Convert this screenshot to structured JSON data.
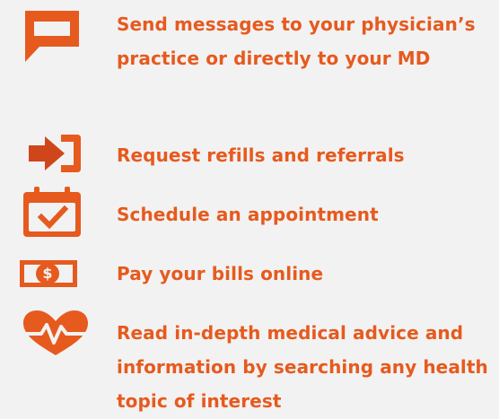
{
  "features": {
    "messages": {
      "icon": "chat-bubble-icon",
      "label": "Send messages to your physician’s practice or directly to your MD"
    },
    "refills": {
      "icon": "arrow-into-door-icon",
      "label": "Request refills and referrals"
    },
    "appointment": {
      "icon": "calendar-check-icon",
      "label": "Schedule an appointment"
    },
    "bills": {
      "icon": "dollar-bill-icon",
      "label": "Pay your bills online",
      "icon_text": "$"
    },
    "advice": {
      "icon": "heart-pulse-icon",
      "label": "Read in-depth medical advice and information by searching any health topic of interest"
    }
  },
  "colors": {
    "accent": "#e65a1e",
    "accent_dark": "#c9431a",
    "background": "#f2f2f2"
  }
}
